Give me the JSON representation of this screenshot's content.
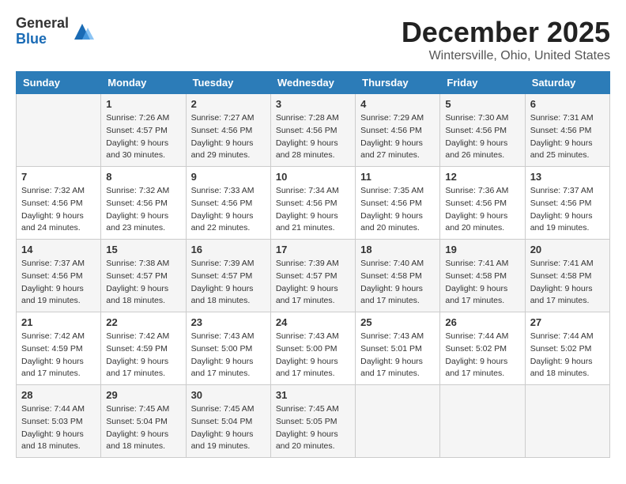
{
  "logo": {
    "general": "General",
    "blue": "Blue"
  },
  "title": "December 2025",
  "location": "Wintersville, Ohio, United States",
  "days_header": [
    "Sunday",
    "Monday",
    "Tuesday",
    "Wednesday",
    "Thursday",
    "Friday",
    "Saturday"
  ],
  "weeks": [
    [
      {
        "day": "",
        "sunrise": "",
        "sunset": "",
        "daylight": ""
      },
      {
        "day": "1",
        "sunrise": "Sunrise: 7:26 AM",
        "sunset": "Sunset: 4:57 PM",
        "daylight": "Daylight: 9 hours and 30 minutes."
      },
      {
        "day": "2",
        "sunrise": "Sunrise: 7:27 AM",
        "sunset": "Sunset: 4:56 PM",
        "daylight": "Daylight: 9 hours and 29 minutes."
      },
      {
        "day": "3",
        "sunrise": "Sunrise: 7:28 AM",
        "sunset": "Sunset: 4:56 PM",
        "daylight": "Daylight: 9 hours and 28 minutes."
      },
      {
        "day": "4",
        "sunrise": "Sunrise: 7:29 AM",
        "sunset": "Sunset: 4:56 PM",
        "daylight": "Daylight: 9 hours and 27 minutes."
      },
      {
        "day": "5",
        "sunrise": "Sunrise: 7:30 AM",
        "sunset": "Sunset: 4:56 PM",
        "daylight": "Daylight: 9 hours and 26 minutes."
      },
      {
        "day": "6",
        "sunrise": "Sunrise: 7:31 AM",
        "sunset": "Sunset: 4:56 PM",
        "daylight": "Daylight: 9 hours and 25 minutes."
      }
    ],
    [
      {
        "day": "7",
        "sunrise": "Sunrise: 7:32 AM",
        "sunset": "Sunset: 4:56 PM",
        "daylight": "Daylight: 9 hours and 24 minutes."
      },
      {
        "day": "8",
        "sunrise": "Sunrise: 7:32 AM",
        "sunset": "Sunset: 4:56 PM",
        "daylight": "Daylight: 9 hours and 23 minutes."
      },
      {
        "day": "9",
        "sunrise": "Sunrise: 7:33 AM",
        "sunset": "Sunset: 4:56 PM",
        "daylight": "Daylight: 9 hours and 22 minutes."
      },
      {
        "day": "10",
        "sunrise": "Sunrise: 7:34 AM",
        "sunset": "Sunset: 4:56 PM",
        "daylight": "Daylight: 9 hours and 21 minutes."
      },
      {
        "day": "11",
        "sunrise": "Sunrise: 7:35 AM",
        "sunset": "Sunset: 4:56 PM",
        "daylight": "Daylight: 9 hours and 20 minutes."
      },
      {
        "day": "12",
        "sunrise": "Sunrise: 7:36 AM",
        "sunset": "Sunset: 4:56 PM",
        "daylight": "Daylight: 9 hours and 20 minutes."
      },
      {
        "day": "13",
        "sunrise": "Sunrise: 7:37 AM",
        "sunset": "Sunset: 4:56 PM",
        "daylight": "Daylight: 9 hours and 19 minutes."
      }
    ],
    [
      {
        "day": "14",
        "sunrise": "Sunrise: 7:37 AM",
        "sunset": "Sunset: 4:56 PM",
        "daylight": "Daylight: 9 hours and 19 minutes."
      },
      {
        "day": "15",
        "sunrise": "Sunrise: 7:38 AM",
        "sunset": "Sunset: 4:57 PM",
        "daylight": "Daylight: 9 hours and 18 minutes."
      },
      {
        "day": "16",
        "sunrise": "Sunrise: 7:39 AM",
        "sunset": "Sunset: 4:57 PM",
        "daylight": "Daylight: 9 hours and 18 minutes."
      },
      {
        "day": "17",
        "sunrise": "Sunrise: 7:39 AM",
        "sunset": "Sunset: 4:57 PM",
        "daylight": "Daylight: 9 hours and 17 minutes."
      },
      {
        "day": "18",
        "sunrise": "Sunrise: 7:40 AM",
        "sunset": "Sunset: 4:58 PM",
        "daylight": "Daylight: 9 hours and 17 minutes."
      },
      {
        "day": "19",
        "sunrise": "Sunrise: 7:41 AM",
        "sunset": "Sunset: 4:58 PM",
        "daylight": "Daylight: 9 hours and 17 minutes."
      },
      {
        "day": "20",
        "sunrise": "Sunrise: 7:41 AM",
        "sunset": "Sunset: 4:58 PM",
        "daylight": "Daylight: 9 hours and 17 minutes."
      }
    ],
    [
      {
        "day": "21",
        "sunrise": "Sunrise: 7:42 AM",
        "sunset": "Sunset: 4:59 PM",
        "daylight": "Daylight: 9 hours and 17 minutes."
      },
      {
        "day": "22",
        "sunrise": "Sunrise: 7:42 AM",
        "sunset": "Sunset: 4:59 PM",
        "daylight": "Daylight: 9 hours and 17 minutes."
      },
      {
        "day": "23",
        "sunrise": "Sunrise: 7:43 AM",
        "sunset": "Sunset: 5:00 PM",
        "daylight": "Daylight: 9 hours and 17 minutes."
      },
      {
        "day": "24",
        "sunrise": "Sunrise: 7:43 AM",
        "sunset": "Sunset: 5:00 PM",
        "daylight": "Daylight: 9 hours and 17 minutes."
      },
      {
        "day": "25",
        "sunrise": "Sunrise: 7:43 AM",
        "sunset": "Sunset: 5:01 PM",
        "daylight": "Daylight: 9 hours and 17 minutes."
      },
      {
        "day": "26",
        "sunrise": "Sunrise: 7:44 AM",
        "sunset": "Sunset: 5:02 PM",
        "daylight": "Daylight: 9 hours and 17 minutes."
      },
      {
        "day": "27",
        "sunrise": "Sunrise: 7:44 AM",
        "sunset": "Sunset: 5:02 PM",
        "daylight": "Daylight: 9 hours and 18 minutes."
      }
    ],
    [
      {
        "day": "28",
        "sunrise": "Sunrise: 7:44 AM",
        "sunset": "Sunset: 5:03 PM",
        "daylight": "Daylight: 9 hours and 18 minutes."
      },
      {
        "day": "29",
        "sunrise": "Sunrise: 7:45 AM",
        "sunset": "Sunset: 5:04 PM",
        "daylight": "Daylight: 9 hours and 18 minutes."
      },
      {
        "day": "30",
        "sunrise": "Sunrise: 7:45 AM",
        "sunset": "Sunset: 5:04 PM",
        "daylight": "Daylight: 9 hours and 19 minutes."
      },
      {
        "day": "31",
        "sunrise": "Sunrise: 7:45 AM",
        "sunset": "Sunset: 5:05 PM",
        "daylight": "Daylight: 9 hours and 20 minutes."
      },
      {
        "day": "",
        "sunrise": "",
        "sunset": "",
        "daylight": ""
      },
      {
        "day": "",
        "sunrise": "",
        "sunset": "",
        "daylight": ""
      },
      {
        "day": "",
        "sunrise": "",
        "sunset": "",
        "daylight": ""
      }
    ]
  ]
}
